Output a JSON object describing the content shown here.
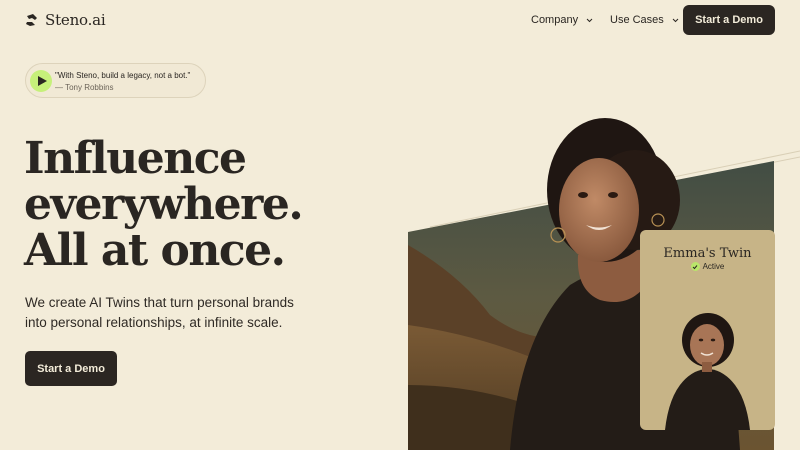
{
  "header": {
    "brand": "Steno.ai",
    "nav": [
      {
        "label": "Company"
      },
      {
        "label": "Use Cases"
      }
    ],
    "cta_label": "Start a Demo"
  },
  "quote": {
    "text": "\"With Steno, build a legacy, not a bot.\"",
    "author": "— Tony Robbins"
  },
  "hero": {
    "title_lines": [
      "Influence",
      "everywhere.",
      "All at once."
    ],
    "subtitle_lines": [
      "We create AI Twins that turn personal brands",
      "into personal relationships, at infinite scale."
    ],
    "cta_label": "Start a Demo"
  },
  "twin_card": {
    "name": "Emma's Twin",
    "status": "Active"
  },
  "colors": {
    "background": "#f3ecd9",
    "primary_dark": "#2b2622",
    "accent_green": "#c6f07a",
    "card_tan": "#c7b487"
  },
  "icons": {
    "logo": "steno-logo-icon",
    "nav_chevron": "chevron-down-icon",
    "play": "play-icon",
    "status": "check-circle-icon"
  }
}
